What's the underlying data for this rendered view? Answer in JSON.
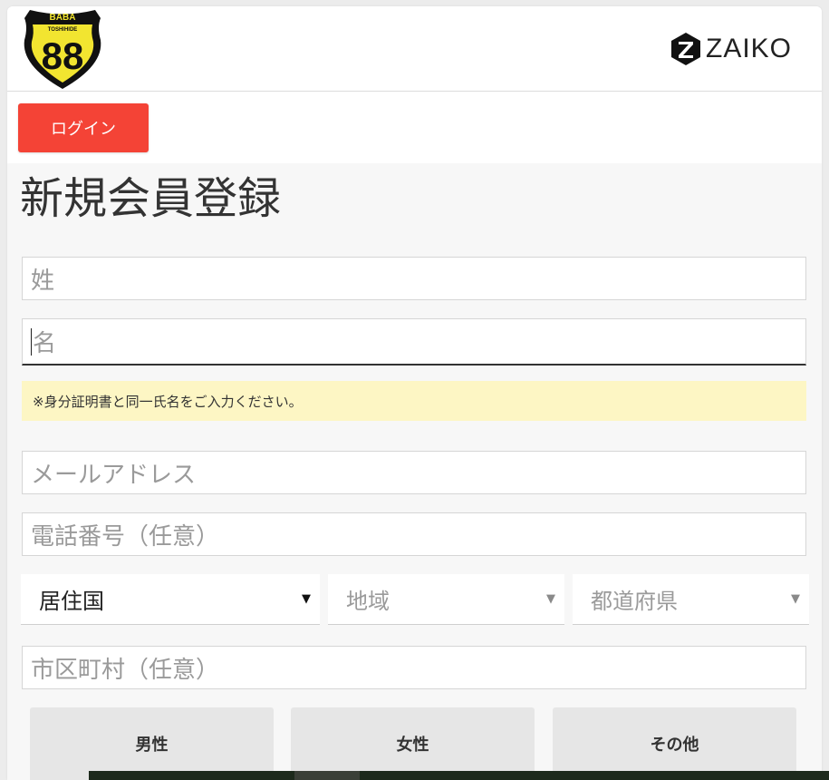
{
  "header": {
    "logo": {
      "top_text": "BABA",
      "sub_text": "TOSHIHIDE",
      "number": "88"
    },
    "brand": {
      "icon": "zaiko-z-icon",
      "name": "ZAIKO"
    }
  },
  "login_button": "ログイン",
  "page_title": "新規会員登録",
  "form": {
    "last_name_placeholder": "姓",
    "first_name_placeholder": "名",
    "name_notice": "※身分証明書と同一氏名をご入力ください。",
    "email_placeholder": "メールアドレス",
    "phone_placeholder": "電話番号（任意）",
    "country_select": "居住国",
    "region_select": "地域",
    "prefecture_select": "都道府県",
    "city_placeholder": "市区町村（任意）",
    "gender_options": [
      "男性",
      "女性",
      "その他"
    ]
  },
  "colors": {
    "login_button": "#f44336",
    "notice_bg": "#fdf6c4",
    "logo_yellow": "#f2e530"
  }
}
